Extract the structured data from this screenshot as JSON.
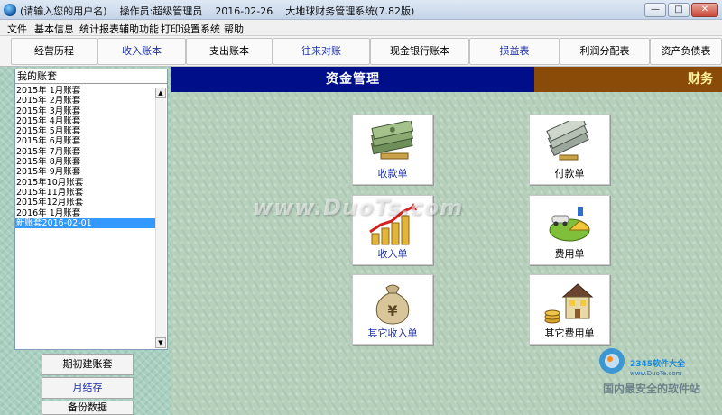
{
  "window": {
    "user_placeholder": "(请输入您的用户名)",
    "operator": "操作员:超级管理员",
    "date": "2016-02-26",
    "app_name": "大地球财务管理系统(7.82版)",
    "min_glyph": "—",
    "max_glyph": "□",
    "close_glyph": "✕"
  },
  "menu": [
    "文件",
    "基本信息",
    "统计报表",
    "辅助功能",
    "打印设置",
    "系统",
    "帮助"
  ],
  "toolbar": [
    "经营历程",
    "收入账本",
    "支出账本",
    "往来对账",
    "现金银行账本",
    "损益表",
    "利润分配表",
    "资产负债表"
  ],
  "sidebar": {
    "list_header": "我的账套",
    "items": [
      "2015年 1月账套",
      "2015年 2月账套",
      "2015年 3月账套",
      "2015年 4月账套",
      "2015年 5月账套",
      "2015年 6月账套",
      "2015年 7月账套",
      "2015年 8月账套",
      "2015年 9月账套",
      "2015年10月账套",
      "2015年11月账套",
      "2015年12月账套",
      "2016年 1月账套",
      "新账套2016-02-01"
    ],
    "selected_index": 13,
    "scroll_up": "▲",
    "scroll_down": "▼",
    "buttons": [
      "期初建账套",
      "月结存",
      "备份数据"
    ]
  },
  "main": {
    "title": "资金管理",
    "title_right": "财务",
    "tiles": [
      "收款单",
      "付款单",
      "收入单",
      "费用单",
      "其它收入单",
      "其它费用单"
    ]
  },
  "watermarks": {
    "center": "www.DuoTs.com",
    "logo": "2345软件大全",
    "logo_url": "www.DuoTe.com",
    "site": "国内最安全的软件站"
  },
  "colors": {
    "title_bar_blue": "#000e8a",
    "title_bar_brown": "#8a4a08",
    "selection": "#3399ff"
  }
}
